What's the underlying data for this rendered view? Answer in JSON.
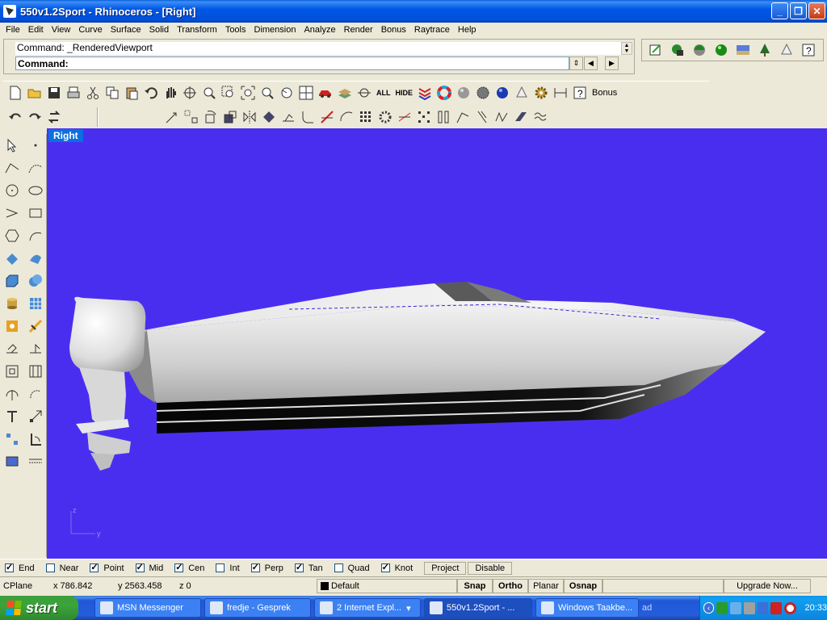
{
  "window": {
    "title": "550v1.2Sport - Rhinoceros - [Right]",
    "minimize": "_",
    "maximize": "❐",
    "close": "✕"
  },
  "menu": [
    "File",
    "Edit",
    "View",
    "Curve",
    "Surface",
    "Solid",
    "Transform",
    "Tools",
    "Dimension",
    "Analyze",
    "Render",
    "Bonus",
    "Raytrace",
    "Help"
  ],
  "command": {
    "history": "Command: _RenderedViewport",
    "prompt_label": "Command:",
    "input_value": ""
  },
  "toolbar": {
    "all_label": "ALL",
    "hide_label": "HIDE",
    "bonus_label": "Bonus"
  },
  "viewport": {
    "title": "Right",
    "background": "#4a2ef0",
    "axis_z": "z",
    "axis_y": "y"
  },
  "osnap": {
    "items": [
      {
        "label": "End",
        "checked": true
      },
      {
        "label": "Near",
        "checked": false
      },
      {
        "label": "Point",
        "checked": true
      },
      {
        "label": "Mid",
        "checked": true
      },
      {
        "label": "Cen",
        "checked": true
      },
      {
        "label": "Int",
        "checked": false
      },
      {
        "label": "Perp",
        "checked": true
      },
      {
        "label": "Tan",
        "checked": true
      },
      {
        "label": "Quad",
        "checked": false
      },
      {
        "label": "Knot",
        "checked": true
      }
    ],
    "project_label": "Project",
    "disable_label": "Disable"
  },
  "status": {
    "cplane": "CPlane",
    "x": "x 786.842",
    "y": "y 2563.458",
    "z": "z 0",
    "layer": "Default",
    "snap": "Snap",
    "ortho": "Ortho",
    "planar": "Planar",
    "osnap": "Osnap",
    "upgrade": "Upgrade Now..."
  },
  "taskbar": {
    "start": "start",
    "tasks": [
      {
        "label": "MSN Messenger",
        "active": false
      },
      {
        "label": "fredje - Gesprek",
        "active": false
      },
      {
        "label": "2 Internet Expl...",
        "active": false
      },
      {
        "label": "550v1.2Sport - ...",
        "active": true
      },
      {
        "label": "Windows Taakbe...",
        "active": false
      }
    ],
    "overflow": "ad",
    "clock": "20:33"
  }
}
